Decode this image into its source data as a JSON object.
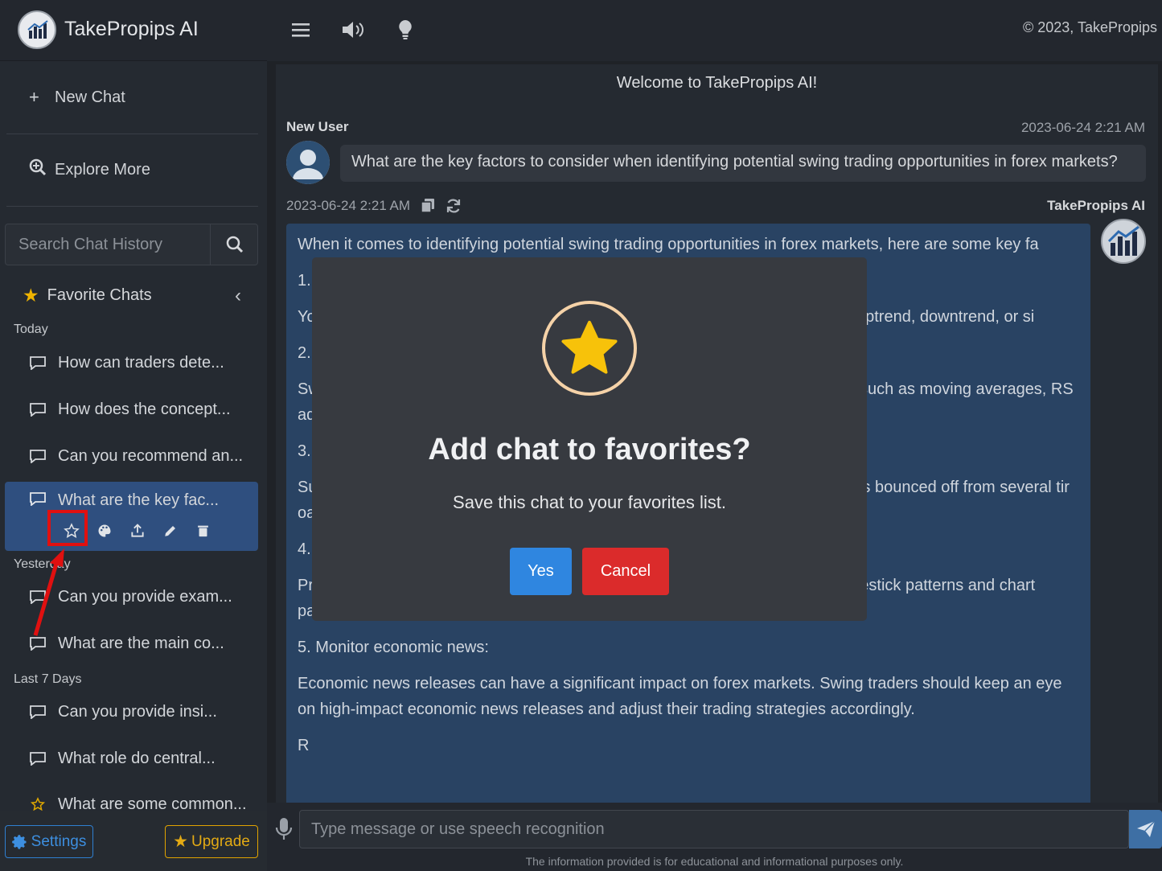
{
  "brand": {
    "title": "TakePropips AI",
    "logo_text": "TakePropips"
  },
  "sidebar": {
    "new_chat": "New Chat",
    "explore_more": "Explore More",
    "search_placeholder": "Search Chat History",
    "favorites_label": "Favorite Chats",
    "groups": [
      {
        "label": "Today",
        "items": [
          "How can traders dete...",
          "How does the concept...",
          "Can you recommend an...",
          "What are the key fac..."
        ]
      },
      {
        "label": "Yesterday",
        "items": [
          "Can you provide exam...",
          "What are the main co..."
        ]
      },
      {
        "label": "Last 7 Days",
        "items": [
          "Can you provide insi...",
          "What role do central...",
          "What are some common..."
        ]
      }
    ],
    "settings_label": "Settings",
    "upgrade_label": "Upgrade"
  },
  "topbar": {
    "copyright": "2023, TakePropips"
  },
  "chat": {
    "welcome": "Welcome to TakePropips AI!",
    "user_name": "New User",
    "user_time": "2023-06-24 2:21 AM",
    "user_message": "What are the key factors to consider when identifying potential swing trading opportunities in forex markets?",
    "ai_time": "2023-06-24 2:21 AM",
    "ai_name": "TakePropips AI",
    "ai_paragraphs": [
      "When it comes to identifying potential swing trading opportunities in forex markets, here are some key fa",
      "1.",
      "Yo                                                                                                                      n uptrend, downtrend, or si",
      "2.",
      "Sw                                                                                                                      s such as moving averages, RS                                                                                                                  ade setups.",
      "3.",
      "Su                                                                                                                      has bounced off from several tir                                                                                                                  oaching these levels.",
      "4.",
      "Price action is the study of how price moves on the charts. You can study candlestick patterns and chart patterns to identify potential swing trading opportunities.",
      "5. Monitor economic news:",
      "Economic news releases can have a significant impact on forex markets. Swing traders should keep an eye on high-impact economic news releases and adjust their trading strategies accordingly.",
      "R"
    ]
  },
  "input": {
    "placeholder": "Type message or use speech recognition",
    "disclaimer": "The information provided is for educational and informational purposes only."
  },
  "modal": {
    "title": "Add chat to favorites?",
    "text": "Save this chat to your favorites list.",
    "yes_label": "Yes",
    "cancel_label": "Cancel"
  },
  "colors": {
    "accent_blue": "#2f86e0",
    "danger_red": "#db2b2b",
    "star_yellow": "#f7c20a",
    "annotation_red": "#e01010"
  }
}
